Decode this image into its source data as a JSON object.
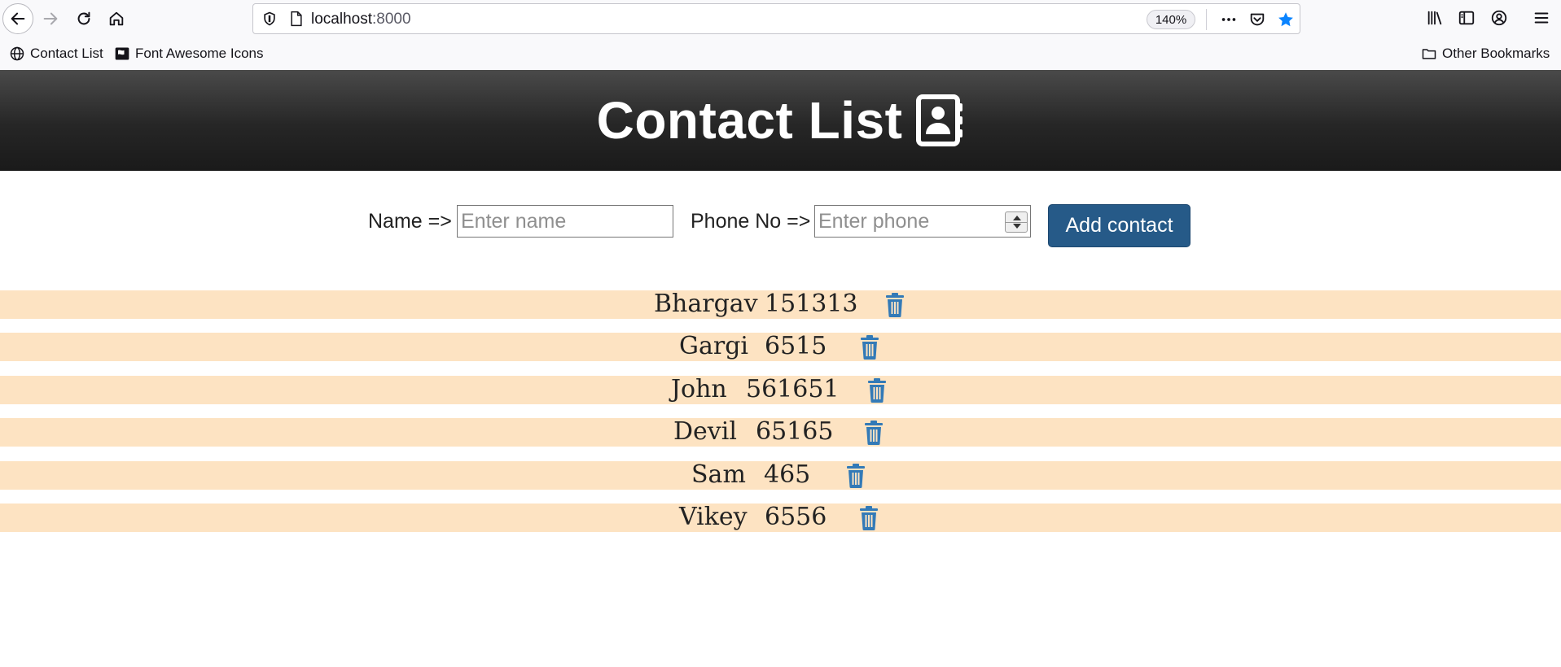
{
  "browser": {
    "url_host": "localhost",
    "url_port": ":8000",
    "zoom": "140%",
    "bookmarks": [
      {
        "label": "Contact List",
        "icon": "globe-icon"
      },
      {
        "label": "Font Awesome Icons",
        "icon": "flag-icon"
      }
    ],
    "other_bookmarks": "Other Bookmarks"
  },
  "header": {
    "title": "Contact List",
    "icon": "address-book-icon"
  },
  "form": {
    "name_label": "Name =>",
    "name_placeholder": "Enter name",
    "phone_label": "Phone No =>",
    "phone_placeholder": "Enter phone",
    "add_button": "Add contact"
  },
  "contacts": [
    {
      "name": "Bhargav",
      "phone": "151313"
    },
    {
      "name": "Gargi",
      "phone": "6515"
    },
    {
      "name": "John",
      "phone": "561651"
    },
    {
      "name": "Devil",
      "phone": "65165"
    },
    {
      "name": "Sam",
      "phone": "465"
    },
    {
      "name": "Vikey",
      "phone": "6556"
    }
  ],
  "colors": {
    "header_bg": "#262626",
    "row_bg": "#fde3c2",
    "button_bg": "#265a88",
    "trash_icon": "#337ab7"
  }
}
